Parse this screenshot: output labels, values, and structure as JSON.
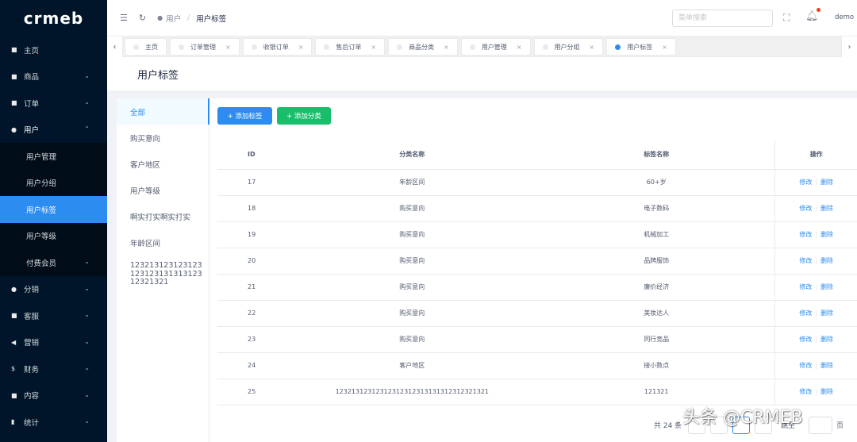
{
  "sidebar": {
    "logo": "crmeb",
    "items": [
      {
        "icon": "home-icon",
        "glyph": "■",
        "label": "主页",
        "arrow": ""
      },
      {
        "icon": "shop-icon",
        "glyph": "■",
        "label": "商品",
        "arrow": "⌄"
      },
      {
        "icon": "cart-icon",
        "glyph": "■",
        "label": "订单",
        "arrow": "⌄"
      },
      {
        "icon": "user-icon",
        "glyph": "●",
        "label": "用户",
        "arrow": "⌃"
      }
    ],
    "user_submenu": [
      {
        "label": "用户管理",
        "arrow": ""
      },
      {
        "label": "用户分组",
        "arrow": ""
      },
      {
        "label": "用户标签",
        "arrow": ""
      },
      {
        "label": "用户等级",
        "arrow": ""
      },
      {
        "label": "付费会员",
        "arrow": "⌄"
      }
    ],
    "items_after": [
      {
        "icon": "distribution-icon",
        "glyph": "●",
        "label": "分销",
        "arrow": "⌄"
      },
      {
        "icon": "service-icon",
        "glyph": "■",
        "label": "客服",
        "arrow": "⌄"
      },
      {
        "icon": "marketing-icon",
        "glyph": "◀",
        "label": "营销",
        "arrow": "⌄"
      },
      {
        "icon": "finance-icon",
        "glyph": "$",
        "label": "财务",
        "arrow": "⌄"
      },
      {
        "icon": "content-icon",
        "glyph": "■",
        "label": "内容",
        "arrow": "⌄"
      },
      {
        "icon": "statistics-icon",
        "glyph": "▮",
        "label": "统计",
        "arrow": "⌄"
      }
    ]
  },
  "header": {
    "breadcrumb_parent": "用户",
    "breadcrumb_sep": "/",
    "breadcrumb_current": "用户标签",
    "search_placeholder": "菜单搜索",
    "username": "demo"
  },
  "tabs": [
    {
      "label": "主页",
      "closable": false,
      "active": false
    },
    {
      "label": "订单管理",
      "closable": true,
      "active": false
    },
    {
      "label": "收银订单",
      "closable": true,
      "active": false
    },
    {
      "label": "售后订单",
      "closable": true,
      "active": false
    },
    {
      "label": "商品分类",
      "closable": true,
      "active": false
    },
    {
      "label": "用户管理",
      "closable": true,
      "active": false
    },
    {
      "label": "用户分组",
      "closable": true,
      "active": false
    },
    {
      "label": "用户标签",
      "closable": true,
      "active": true
    }
  ],
  "page": {
    "title": "用户标签"
  },
  "categories": [
    {
      "label": "全部",
      "active": true,
      "multi": false
    },
    {
      "label": "购买意向",
      "active": false,
      "multi": false
    },
    {
      "label": "客户地区",
      "active": false,
      "multi": false
    },
    {
      "label": "用户等级",
      "active": false,
      "multi": false
    },
    {
      "label": "啊实打实啊实打实",
      "active": false,
      "multi": false
    },
    {
      "label": "年龄区间",
      "active": false,
      "multi": false
    },
    {
      "label": "12321312312312312312313131312312321321",
      "active": false,
      "multi": true
    }
  ],
  "buttons": {
    "add_tag": "+ 添加标签",
    "add_category": "+ 添加分类"
  },
  "table": {
    "headers": {
      "id": "ID",
      "category": "分类名称",
      "tag": "标签名称",
      "ops": "操作"
    },
    "edit_label": "修改",
    "delete_label": "删除",
    "rows": [
      {
        "id": "17",
        "category": "年龄区间",
        "tag": "60+岁"
      },
      {
        "id": "18",
        "category": "购买意向",
        "tag": "电子数码"
      },
      {
        "id": "19",
        "category": "购买意向",
        "tag": "机械加工"
      },
      {
        "id": "20",
        "category": "购买意向",
        "tag": "品牌服饰"
      },
      {
        "id": "21",
        "category": "购买意向",
        "tag": "廉价经济"
      },
      {
        "id": "22",
        "category": "购买意向",
        "tag": "美妆达人"
      },
      {
        "id": "23",
        "category": "购买意向",
        "tag": "同行竞品"
      },
      {
        "id": "24",
        "category": "客户地区",
        "tag": "接小数点"
      },
      {
        "id": "25",
        "category": "12321312312312312312313131312312321321",
        "tag": "121321"
      }
    ]
  },
  "pager": {
    "total": "共 24 条",
    "goto": "跳至",
    "page_unit": "页"
  },
  "watermark": "头条 @CRMEB"
}
